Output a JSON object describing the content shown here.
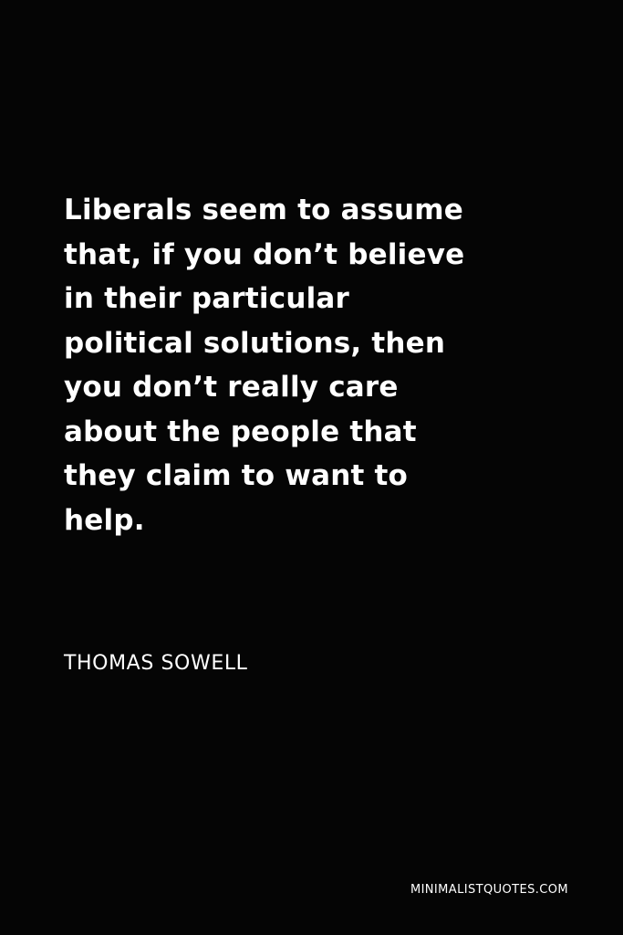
{
  "quote": {
    "lines": [
      "Liberals seem to assume",
      "that, if you don’t believe",
      "in their particular",
      "political solutions, then",
      "you don’t really care",
      "about the people that",
      "they claim to want to",
      "help."
    ]
  },
  "author": "THOMAS SOWELL",
  "watermark": "MINIMALISTQUOTES.COM",
  "colors": {
    "background": "#050505",
    "text": "#ffffff"
  }
}
